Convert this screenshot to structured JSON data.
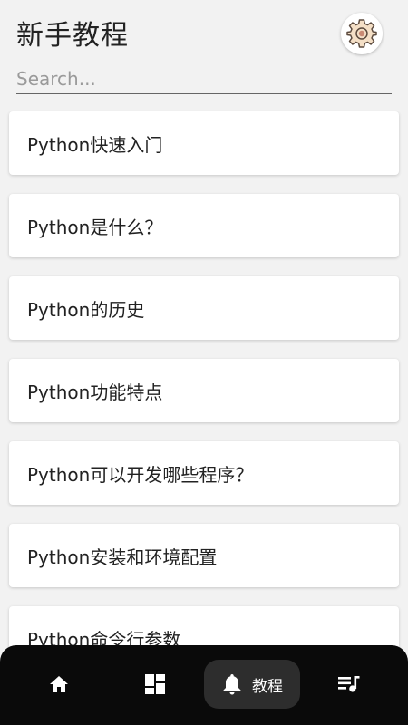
{
  "header": {
    "title": "新手教程",
    "settings_icon": "gear-icon"
  },
  "search": {
    "placeholder": "Search...",
    "value": ""
  },
  "tutorials": [
    {
      "label": "Python快速入门"
    },
    {
      "label": "Python是什么？"
    },
    {
      "label": "Python的历史"
    },
    {
      "label": "Python功能特点"
    },
    {
      "label": "Python可以开发哪些程序？"
    },
    {
      "label": "Python安装和环境配置"
    },
    {
      "label": "Python命令行参数"
    }
  ],
  "bottom_nav": {
    "items": [
      {
        "icon": "home-icon"
      },
      {
        "icon": "dashboard-icon"
      },
      {
        "icon": "bell-icon",
        "label": "教程",
        "active": true
      },
      {
        "icon": "playlist-icon"
      }
    ]
  },
  "colors": {
    "background": "#f2f2f2",
    "nav_background": "#0a0a0a",
    "nav_active": "#2d2d2d",
    "text": "#222222"
  }
}
